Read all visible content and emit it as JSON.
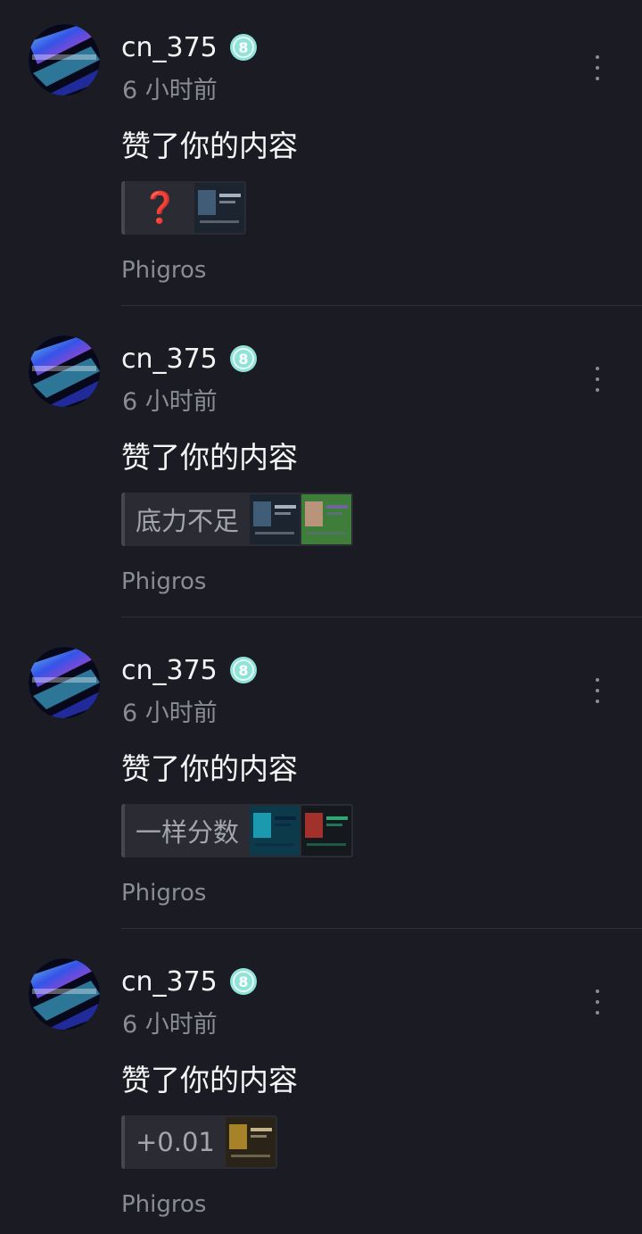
{
  "notifications": [
    {
      "username": "cn_375",
      "level": "8",
      "time": "6 小时前",
      "action": "赞了你的内容",
      "quote": "❓",
      "quote_is_emoji": true,
      "thumbnails": [
        "dark-score-screenshot"
      ],
      "source": "Phigros"
    },
    {
      "username": "cn_375",
      "level": "8",
      "time": "6 小时前",
      "action": "赞了你的内容",
      "quote": "底力不足",
      "quote_is_emoji": false,
      "thumbnails": [
        "dark-score-screenshot",
        "anime-character-image"
      ],
      "source": "Phigros"
    },
    {
      "username": "cn_375",
      "level": "8",
      "time": "6 小时前",
      "action": "赞了你的内容",
      "quote": "一样分数",
      "quote_is_emoji": false,
      "thumbnails": [
        "teal-score-screenshot",
        "dark-result-screenshot"
      ],
      "source": "Phigros"
    },
    {
      "username": "cn_375",
      "level": "8",
      "time": "6 小时前",
      "action": "赞了你的内容",
      "quote": "+0.01",
      "quote_is_emoji": false,
      "thumbnails": [
        "gold-score-screenshot"
      ],
      "source": "Phigros"
    }
  ],
  "colors": {
    "background": "#1a1b23",
    "badge": "#8fe3d8",
    "muted_text": "#8a8c95",
    "quote_bg": "#2a2b33"
  }
}
